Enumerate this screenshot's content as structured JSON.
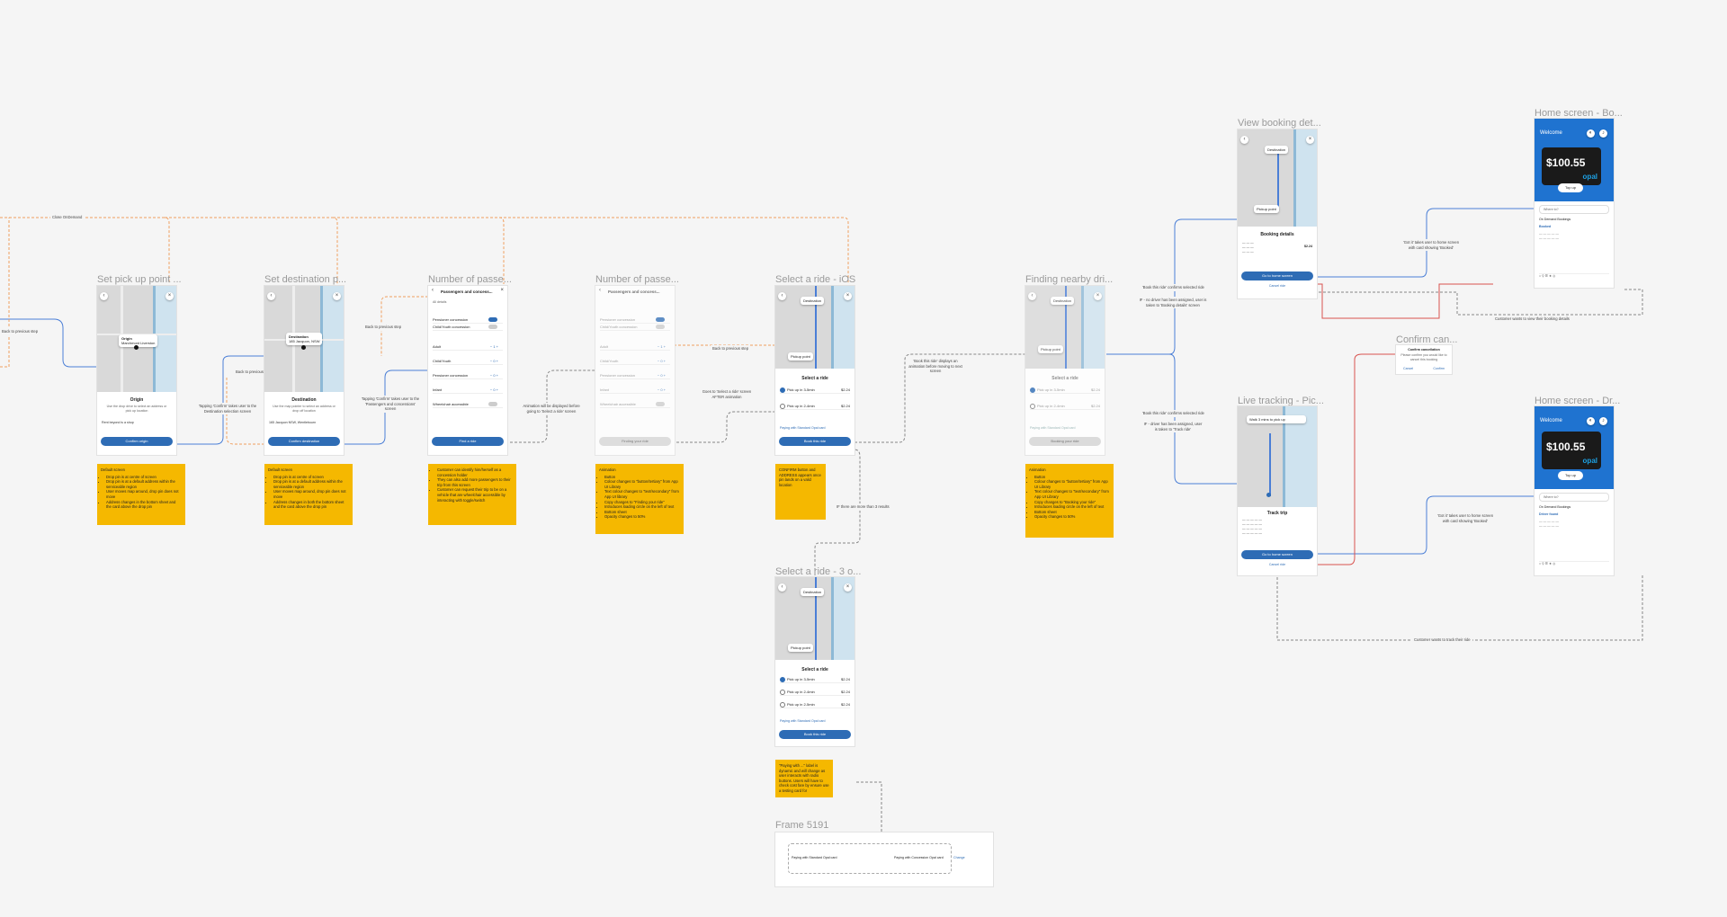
{
  "frames": {
    "pickup": "Set pick up point ...",
    "destination": "Set destination p...",
    "passengers1": "Number of passe...",
    "passengers2": "Number of passe...",
    "select_ios": "Select a ride - iOS",
    "select_3": "Select a ride - 3 o...",
    "finding": "Finding nearby dri...",
    "view_booking": "View booking det...",
    "live_tracking": "Live tracking - Pic...",
    "confirm_cancel": "Confirm can...",
    "home_booked": "Home screen - Bo...",
    "home_driver": "Home screen - Dr...",
    "frame5191": "Frame 5191"
  },
  "pickup": {
    "bubble_title": "Origin",
    "bubble_sub": "Marchmont Liverston",
    "sheet_title": "Origin",
    "desc": "Use the drop drive to select an address or pick up location",
    "field": "Rent beyond is a shop",
    "button": "Confirm origin"
  },
  "destination": {
    "bubble_title": "Destination",
    "bubble_sub": "185 Jacquon, NSW",
    "sheet_title": "Destination",
    "desc": "Use the map pointer to select an address or drop off location",
    "field": "165 Jacquon NSW, Wentlebourn",
    "button": "Confirm destination"
  },
  "passengers": {
    "title": "Passengers and concess...",
    "section": "All details",
    "opt1": "Pensioner concession",
    "opt2": "Child/Youth concession",
    "sub1": "Adult",
    "sub2": "Child/Youth",
    "sub3": "Pensioner concession",
    "sub4": "Infant",
    "access": "Wheelchair accessible",
    "button1": "Find a ride",
    "button2": "Finding your ride"
  },
  "select": {
    "bubble1": "Destination",
    "bubble2": "Pickup point",
    "sheet_title": "Select a ride",
    "ride1": "Pick up in 3-5min",
    "ride2": "Pick up in 2-4min",
    "ride3": "Pick up in 2-5min",
    "price1": "$2.24",
    "price2": "$2.24",
    "price3": "$2.24",
    "link": "Paying with Standard Opal card",
    "button": "Book this ride"
  },
  "finding": {
    "sheet_title": "Select a ride",
    "button": "Booking your ride"
  },
  "view_booking": {
    "bubble1": "Destination",
    "bubble2": "Pickup point",
    "title": "Booking details",
    "price": "$2.24",
    "button": "Go to home screen",
    "cancel": "Cancel ride"
  },
  "live": {
    "banner": "Walk 3 mins to pick up",
    "title": "Track trip",
    "button": "Go to home screen",
    "cancel": "Cancel ride"
  },
  "confirm": {
    "title": "Confirm cancellation",
    "desc": "Please confirm you would like to cancel this booking",
    "cancel": "Cancel",
    "confirm": "Confirm"
  },
  "home": {
    "welcome": "Welcome",
    "balance": "$100.55",
    "brand": "opal",
    "topup": "Top up",
    "search": "Where to?",
    "ondemand": "On Demand Bookings",
    "booked": "Booked",
    "driver": "Driver found"
  },
  "frame5191": {
    "item1": "Paying with Standard Opal card",
    "item2": "Paying with Concession Opal card",
    "link": "Change"
  },
  "stickies": {
    "pickup": {
      "head": "Default screen",
      "items": [
        "Drop pin is at centre of screen",
        "Drop pin is at a default address within the serviceable region",
        "User moves map around, drop pin does not move",
        "Address changes in the bottom sheet and the card above the drop pin"
      ]
    },
    "destination": {
      "head": "Default screen",
      "items": [
        "Drop pin is at centre of screen",
        "Drop pin is at a default address within the serviceable region",
        "User moves map around, drop pin does not move",
        "Address changes in both the bottom sheet and the card above the drop pin"
      ]
    },
    "passengers": {
      "items": [
        "Customer can identify him/herself as a concession holder",
        "They can also add more passengers to their trip from this screen",
        "Customer can request their trip to be on a vehicle that are wheelchair accessible by interacting with toggle/switch"
      ]
    },
    "animation": {
      "head": "Animation",
      "items": [
        "Button",
        "Colour changes to \"button/tertiary\" from App UI Library",
        "Text colour changes to \"text/secondary\" from App UI library",
        "Copy changes to \"Finding your ride\"",
        "Introduces loading circle on the left of text",
        "Bottom sheet",
        "Opacity changes to 50%"
      ]
    },
    "select": {
      "text": "CONFIRM button and ADDRESS appears once pin lands on a valid location"
    },
    "finding": {
      "head": "Animation",
      "items": [
        "Button",
        "Colour changes to \"button/tertiary\" from App UI Library",
        "Text colour changes to \"text/secondary\" from App UI Library",
        "Copy changes to \"Booking your ride\"",
        "Introduces loading circle on the left of text",
        "Bottom sheet",
        "Opacity changes to 50%"
      ]
    },
    "select3": {
      "text": "\"Paying with ...\" label is dynamic and will change as user interacts with radio buttons. Users will have to check cost fare by ensure use a testing card for"
    }
  },
  "notes": {
    "close_ondemand": "Close OnDemand",
    "back_prev": "Back to previous step",
    "back_pickup": "Back to previous screen",
    "tap_confirm": "Tapping 'Confirm' takes user to the Destination selection screen",
    "tap_confirm2": "Tapping 'Confirm' takes user to the 'Passengers and concessions' screen",
    "back_prev2": "Back to previous step",
    "anim_note": "Animation will be displayed before going to 'Select a ride' screen",
    "back_prev3": "Back to previous step",
    "goes_to": "Goes to 'Select a ride' screen AFTER animation",
    "book_note": "'Book this ride' displays an animation before moving to next screen",
    "if_more": "IF there are more than 3 results",
    "book_confirm": "'Book this ride' confirms selected ride",
    "if_no_driver": "IF - no driver has been assigned, user is taken to 'Booking details' screen",
    "book_confirm2": "'Book this ride' confirms selected ride",
    "if_driver": "IF - driver has been assigned, user is taken to 'Track ride'",
    "got_it": "'Got it' takes user to home screen with card showing 'Booked'",
    "got_it2": "'Got it' takes user to home screen with card showing 'Booked'",
    "customer_view": "Customer wants to view their booking details",
    "customer_track": "Customer wants to track their ride"
  },
  "colors": {
    "accent": "#2e6cb5",
    "sticky": "#f5b800",
    "home": "#1f73d0",
    "connector_blue": "#4a7ed6",
    "connector_orange": "#f0a060",
    "connector_red": "#d9534f"
  }
}
